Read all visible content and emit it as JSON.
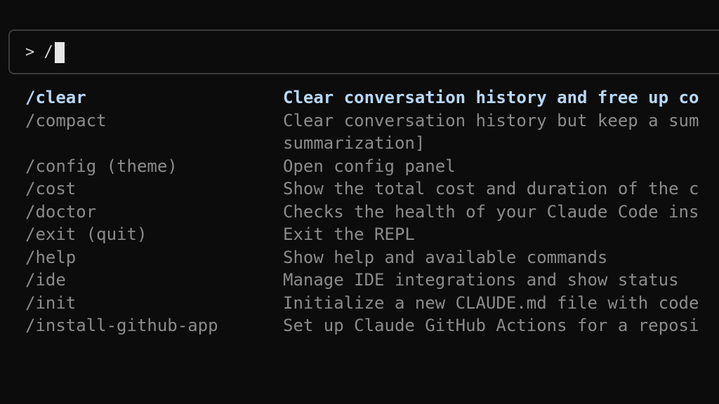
{
  "prompt": {
    "symbol": ">",
    "input_value": "/"
  },
  "commands": [
    {
      "name": "/clear",
      "description": "Clear conversation history and free up co"
    },
    {
      "name": "/compact",
      "description": "Clear conversation history but keep a sum",
      "description_line2": "summarization]"
    },
    {
      "name": "/config (theme)",
      "description": "Open config panel"
    },
    {
      "name": "/cost",
      "description": "Show the total cost and duration of the c"
    },
    {
      "name": "/doctor",
      "description": "Checks the health of your Claude Code ins"
    },
    {
      "name": "/exit (quit)",
      "description": "Exit the REPL"
    },
    {
      "name": "/help",
      "description": "Show help and available commands"
    },
    {
      "name": "/ide",
      "description": "Manage IDE integrations and show status"
    },
    {
      "name": "/init",
      "description": "Initialize a new CLAUDE.md file with code"
    },
    {
      "name": "/install-github-app",
      "description": "Set up Claude GitHub Actions for a reposi"
    }
  ],
  "colors": {
    "background": "#0c0c0c",
    "selected": "#b8d7f5",
    "muted": "#8b8b8b",
    "border": "#3c3c3c"
  }
}
